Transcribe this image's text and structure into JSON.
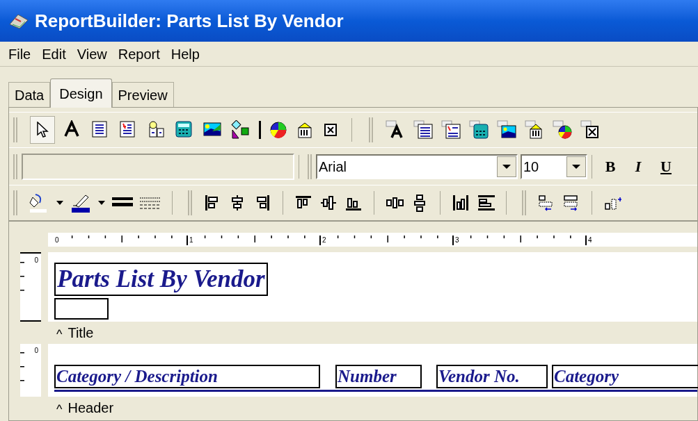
{
  "window": {
    "title": "ReportBuilder: Parts List By Vendor"
  },
  "menu": [
    "File",
    "Edit",
    "View",
    "Report",
    "Help"
  ],
  "tabs": [
    {
      "label": "Data",
      "selected": false
    },
    {
      "label": "Design",
      "selected": true
    },
    {
      "label": "Preview",
      "selected": false
    }
  ],
  "components_toolbar": {
    "pointer_selected": true
  },
  "format_toolbar": {
    "font": "Arial",
    "size": "10",
    "bold": "B",
    "italic": "I",
    "underline": "U"
  },
  "ruler": [
    "0",
    "1",
    "2",
    "3",
    "4"
  ],
  "bands": [
    {
      "kind": "title",
      "ruler": "0",
      "label": "Title",
      "caret": "^",
      "objects": [
        {
          "kind": "title",
          "text": "Parts List By Vendor"
        },
        {
          "kind": "empty"
        }
      ]
    },
    {
      "kind": "header",
      "ruler": "0",
      "label": "Header",
      "caret": "^",
      "objects": [
        {
          "kind": "field",
          "text": "Category / Description"
        },
        {
          "kind": "field",
          "text": "Number"
        },
        {
          "kind": "field",
          "text": "Vendor No."
        },
        {
          "kind": "field",
          "text": "Category"
        }
      ]
    }
  ]
}
